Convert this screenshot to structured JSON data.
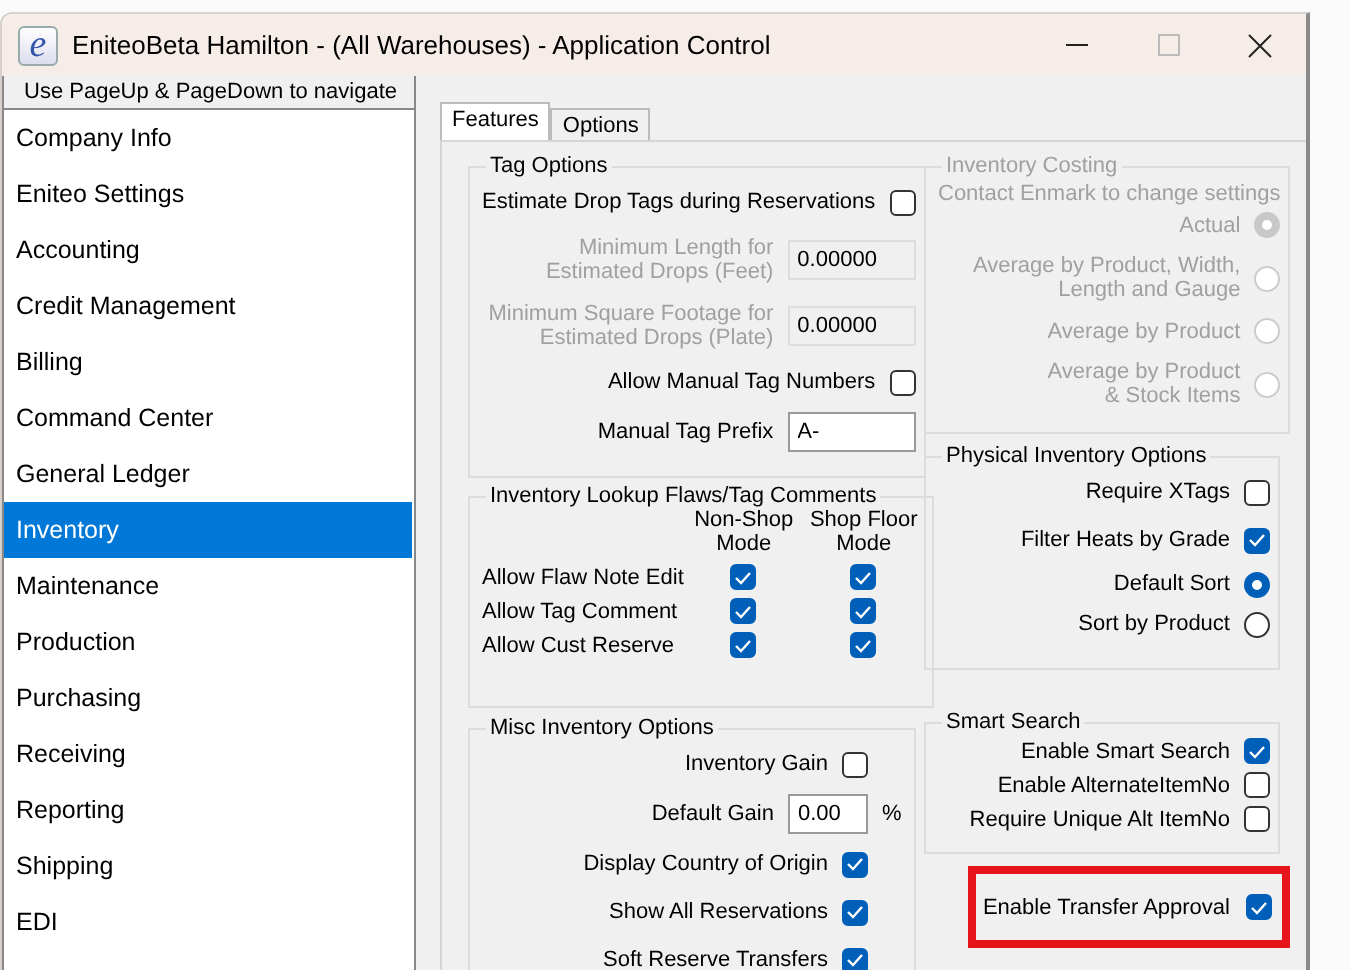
{
  "window": {
    "logo": "e",
    "title": "EniteoBeta Hamilton - (All Warehouses) - Application Control",
    "maximize_disabled": true
  },
  "sidebar": {
    "hint": "Use PageUp & PageDown to navigate",
    "items": [
      {
        "label": "Company Info",
        "selected": false
      },
      {
        "label": "Eniteo Settings",
        "selected": false
      },
      {
        "label": "Accounting",
        "selected": false
      },
      {
        "label": "Credit Management",
        "selected": false
      },
      {
        "label": "Billing",
        "selected": false
      },
      {
        "label": "Command Center",
        "selected": false
      },
      {
        "label": "General Ledger",
        "selected": false
      },
      {
        "label": "Inventory",
        "selected": true
      },
      {
        "label": "Maintenance",
        "selected": false
      },
      {
        "label": "Production",
        "selected": false
      },
      {
        "label": "Purchasing",
        "selected": false
      },
      {
        "label": "Receiving",
        "selected": false
      },
      {
        "label": "Reporting",
        "selected": false
      },
      {
        "label": "Shipping",
        "selected": false
      },
      {
        "label": "EDI",
        "selected": false
      }
    ]
  },
  "tabs": [
    {
      "label": "Features",
      "selected": true
    },
    {
      "label": "Options",
      "selected": false
    }
  ],
  "tag_options": {
    "title": "Tag Options",
    "rows": [
      {
        "kind": "checkbox",
        "label": "Estimate Drop Tags during Reservations",
        "checked": false
      },
      {
        "kind": "field",
        "label": "Minimum Length for\nEstimated Drops (Feet)",
        "value": "0.00000",
        "disabled": true
      },
      {
        "kind": "field",
        "label": "Minimum Square Footage for\nEstimated Drops (Plate)",
        "value": "0.00000",
        "disabled": true
      },
      {
        "kind": "checkbox",
        "label": "Allow Manual Tag Numbers",
        "checked": false
      },
      {
        "kind": "field",
        "label": "Manual Tag Prefix",
        "value": "A-",
        "disabled": false
      }
    ]
  },
  "lookup": {
    "title": "Inventory Lookup Flaws/Tag Comments",
    "columns": [
      "Non-Shop\nMode",
      "Shop Floor\nMode"
    ],
    "rows": [
      {
        "label": "Allow Flaw Note Edit",
        "checks": [
          {
            "checked": true
          },
          {
            "checked": true
          }
        ]
      },
      {
        "label": "Allow Tag Comment",
        "checks": [
          {
            "checked": true
          },
          {
            "checked": true
          }
        ]
      },
      {
        "label": "Allow Cust Reserve",
        "checks": [
          {
            "checked": true
          },
          {
            "checked": true
          }
        ]
      }
    ]
  },
  "misc": {
    "title": "Misc Inventory Options",
    "rows": [
      {
        "kind": "checkbox",
        "label": "Inventory Gain",
        "checked": false
      },
      {
        "kind": "field",
        "label": "Default Gain",
        "value": "0.00",
        "unit": "%",
        "disabled": false
      },
      {
        "kind": "checkbox",
        "label": "Display Country of Origin",
        "checked": true
      },
      {
        "kind": "checkbox",
        "label": "Show All Reservations",
        "checked": true
      },
      {
        "kind": "checkbox",
        "label": "Soft Reserve Transfers",
        "checked": true
      }
    ]
  },
  "costing": {
    "title": "Inventory Costing",
    "note": "Contact Enmark to change settings",
    "disabled": true,
    "options": [
      {
        "label": "Actual",
        "selected": true
      },
      {
        "label": "Average by Product, Width,\nLength and Gauge",
        "selected": false
      },
      {
        "label": "Average by Product",
        "selected": false
      },
      {
        "label": "Average by Product\n& Stock Items",
        "selected": false
      }
    ]
  },
  "physical": {
    "title": "Physical Inventory Options",
    "rows": [
      {
        "kind": "checkbox",
        "label": "Require XTags",
        "checked": false
      },
      {
        "kind": "checkbox",
        "label": "Filter Heats by Grade",
        "checked": true
      },
      {
        "kind": "radio",
        "label": "Default Sort",
        "selected": true
      },
      {
        "kind": "radio",
        "label": "Sort by Product",
        "selected": false
      }
    ]
  },
  "smart_search": {
    "title": "Smart Search",
    "rows": [
      {
        "kind": "checkbox",
        "label": "Enable Smart Search",
        "checked": true
      },
      {
        "kind": "checkbox",
        "label": "Enable AlternateItemNo",
        "checked": false
      },
      {
        "kind": "checkbox",
        "label": "Require Unique Alt ItemNo",
        "checked": false
      }
    ]
  },
  "transfer_approval": {
    "label": "Enable Transfer Approval",
    "checked": true,
    "highlighted": true
  }
}
